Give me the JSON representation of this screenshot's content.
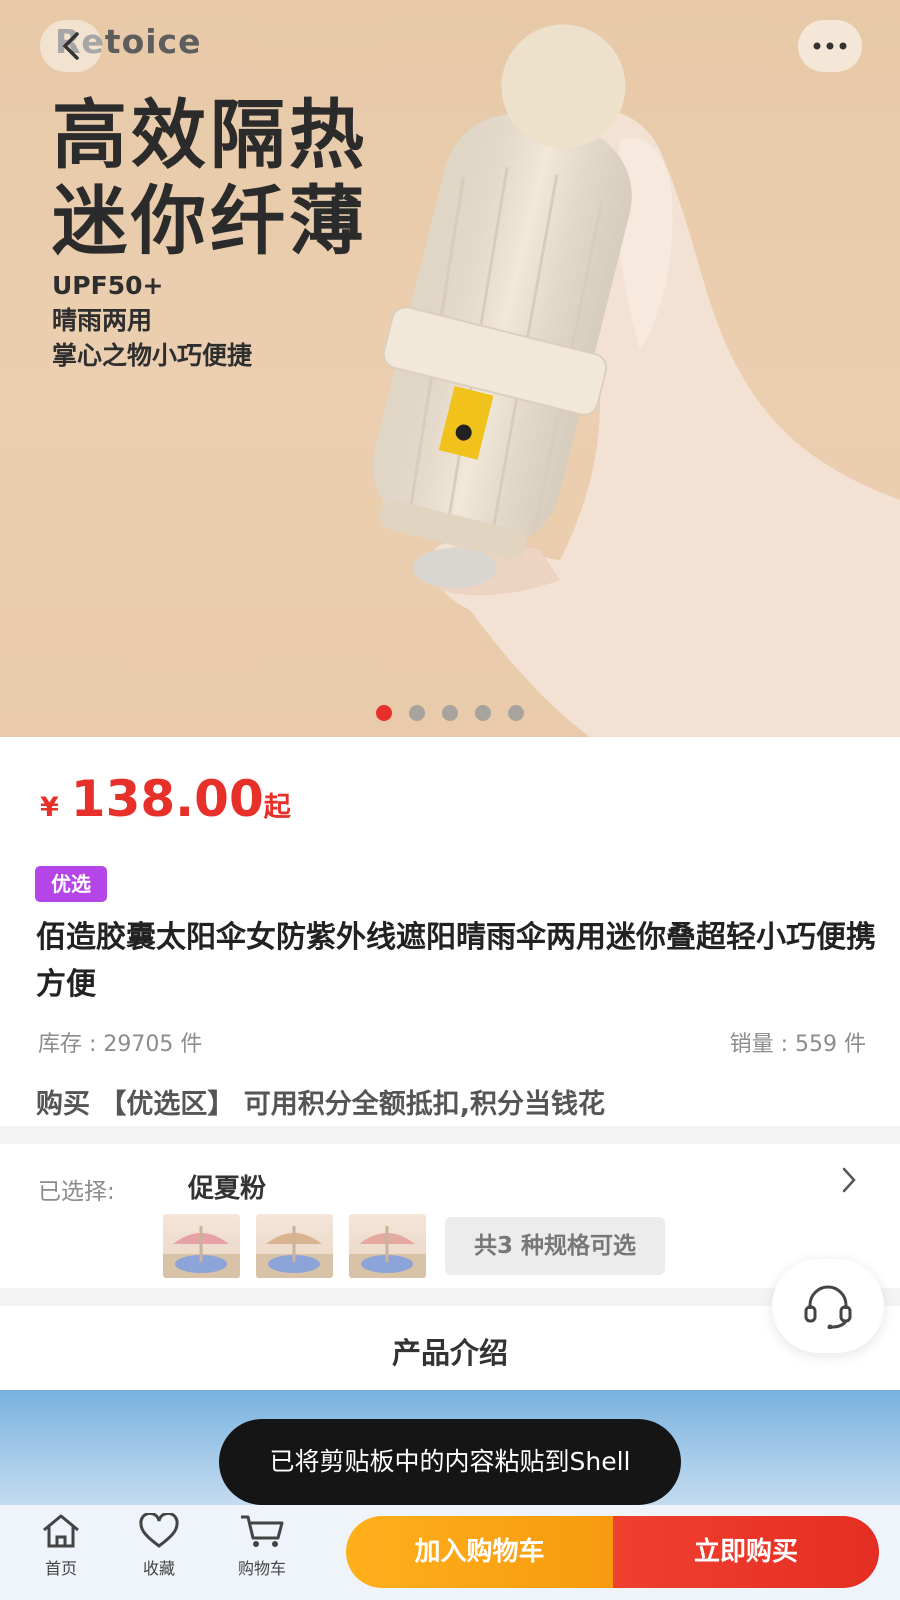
{
  "hero": {
    "brand": "Retoice",
    "headline_line1": "高效隔热",
    "headline_line2": "迷你纤薄",
    "sub_line1": "UPF50+",
    "sub_line2": "晴雨两用",
    "sub_line3": "掌心之物小巧便捷",
    "carousel_count": 5,
    "carousel_active_index": 0
  },
  "product": {
    "currency": "¥",
    "price": "138.00",
    "price_suffix": "起",
    "badge": "优选",
    "title": "佰造胶囊太阳伞女防紫外线遮阳晴雨伞两用迷你叠超轻小巧便携方便",
    "stock": "库存 : 29705 件",
    "sales": "销量 : 559 件",
    "promo": "购买 【优选区】 可用积分全额抵扣,积分当钱花"
  },
  "spec": {
    "label": "已选择:",
    "selected": "促夏粉",
    "count_text": "共3 种规格可选"
  },
  "section": {
    "title": "产品介绍"
  },
  "toast": {
    "text": "已将剪贴板中的内容粘贴到Shell"
  },
  "bottom_nav": {
    "home": "首页",
    "favorite": "收藏",
    "cart": "购物车",
    "add_to_cart": "加入购物车",
    "buy_now": "立即购买"
  },
  "colors": {
    "accent_red": "#e8302a",
    "badge_purple": "#b545e6",
    "cart_orange": "#f8a015"
  }
}
